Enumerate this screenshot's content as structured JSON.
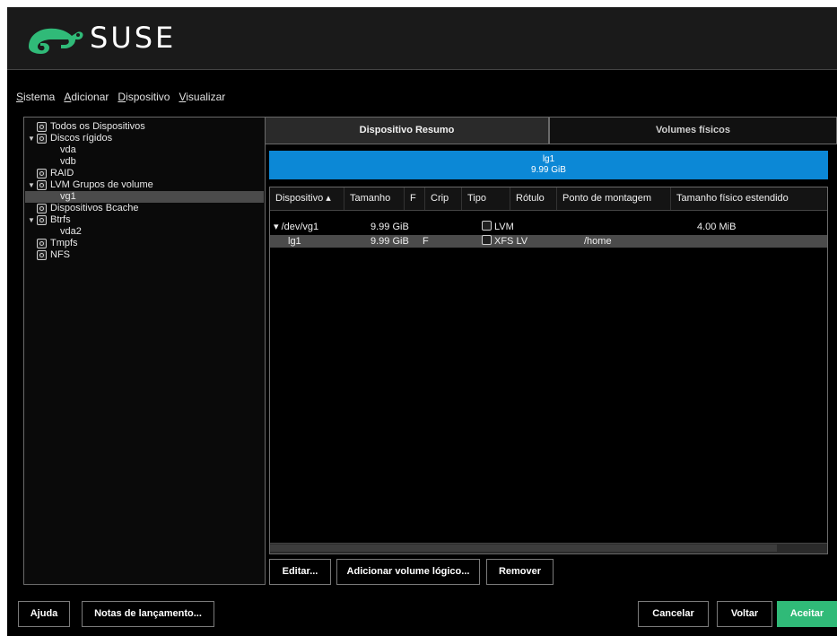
{
  "brand": {
    "name": "SUSE",
    "color": "#30ba78"
  },
  "menu": [
    "Sistema",
    "Adicionar",
    "Dispositivo",
    "Visualizar"
  ],
  "tree": [
    {
      "label": "Todos os Dispositivos",
      "icon": "monitor-icon",
      "expander": ""
    },
    {
      "label": "Discos rígidos",
      "icon": "disk-icon",
      "expander": "▼"
    },
    {
      "label": "vda",
      "icon": "",
      "expander": ""
    },
    {
      "label": "vdb",
      "icon": "",
      "expander": ""
    },
    {
      "label": "RAID",
      "icon": "raid-icon",
      "expander": ""
    },
    {
      "label": "LVM Grupos de volume",
      "icon": "lvm-icon",
      "expander": "▼"
    },
    {
      "label": "vg1",
      "icon": "",
      "expander": "",
      "selected": true
    },
    {
      "label": "Dispositivos Bcache",
      "icon": "bcache-icon",
      "expander": ""
    },
    {
      "label": "Btrfs",
      "icon": "btrfs-icon",
      "expander": "▼"
    },
    {
      "label": "vda2",
      "icon": "",
      "expander": ""
    },
    {
      "label": "Tmpfs",
      "icon": "tmpfs-icon",
      "expander": ""
    },
    {
      "label": "NFS",
      "icon": "nfs-icon",
      "expander": ""
    }
  ],
  "tabs": {
    "summary": "Dispositivo Resumo",
    "physical_volumes": "Volumes físicos"
  },
  "volume_bar": {
    "name": "lg1",
    "size": "9.99 GiB"
  },
  "table": {
    "columns": [
      "Dispositivo ▴",
      "Tamanho",
      "F",
      "Crip",
      "Tipo",
      "Rótulo",
      "Ponto de montagem",
      "Tamanho físico estendido"
    ],
    "rows": [
      {
        "device": "▾ /dev/vg1",
        "size": "9.99 GiB",
        "f": "",
        "crypt": "",
        "type": "LVM",
        "label": "",
        "mount": "",
        "pe_size": "4.00 MiB"
      },
      {
        "device": "lg1",
        "size": "9.99 GiB",
        "f": "F",
        "crypt": "",
        "type": "XFS LV",
        "label": "",
        "mount": "/home",
        "pe_size": "",
        "selected": true
      }
    ]
  },
  "actions": {
    "edit": "Editar...",
    "add_lv": "Adicionar volume lógico...",
    "remove": "Remover"
  },
  "footer": {
    "help": "Ajuda",
    "release_notes": "Notas de lançamento...",
    "cancel": "Cancelar",
    "back": "Voltar",
    "accept": "Aceitar"
  }
}
